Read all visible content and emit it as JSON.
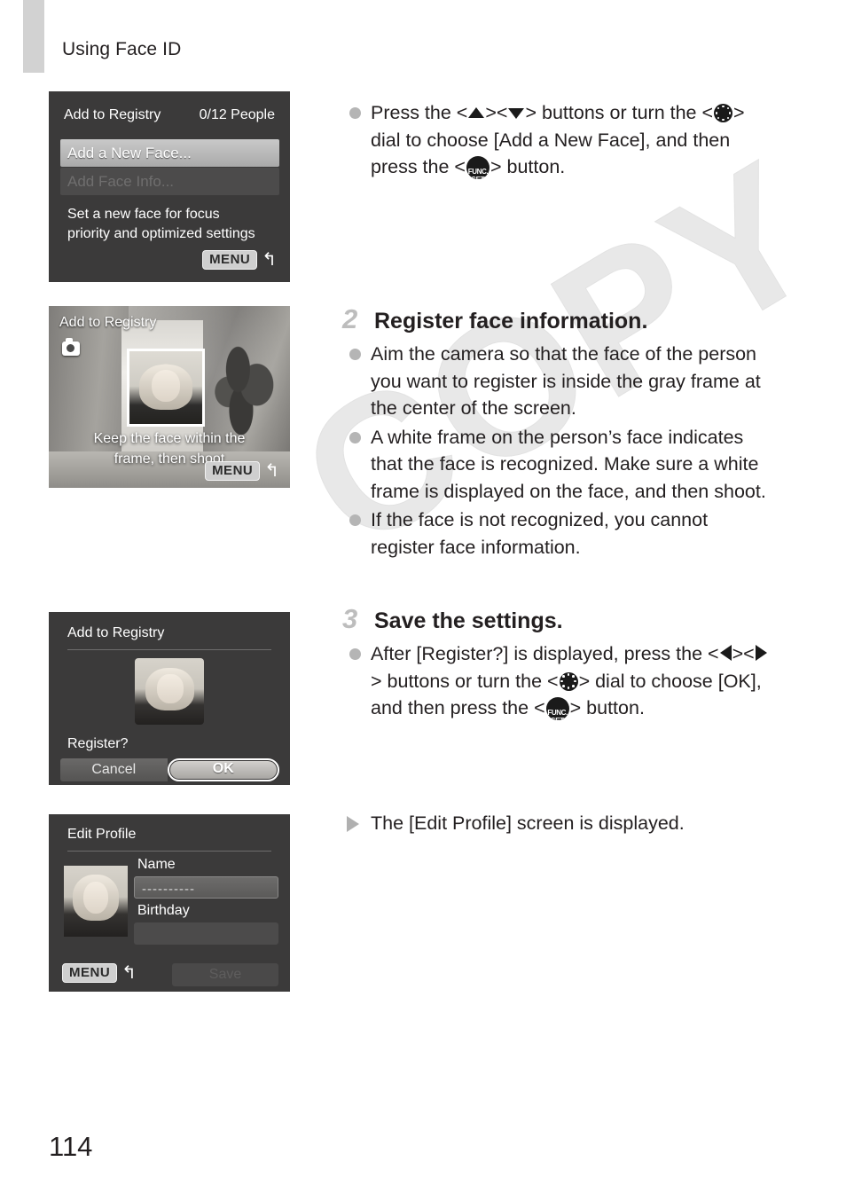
{
  "page": {
    "header": "Using Face ID",
    "number": "114",
    "watermark": "COPY"
  },
  "screens": {
    "add_to_registry_menu": {
      "title": "Add to Registry",
      "counter": "0/12 People",
      "item_selected": "Add a New Face...",
      "item_disabled": "Add Face Info...",
      "description_line1": "Set a new face for focus",
      "description_line2": "priority and optimized settings",
      "menu_label": "MENU",
      "menu_arrow": "↰"
    },
    "face_capture": {
      "title": "Add to Registry",
      "caption_line1": "Keep the face within the",
      "caption_line2": "frame, then shoot",
      "menu_label": "MENU",
      "menu_arrow": "↰"
    },
    "register_confirm": {
      "title": "Add to Registry",
      "question": "Register?",
      "cancel_label": "Cancel",
      "ok_label": "OK"
    },
    "edit_profile": {
      "title": "Edit Profile",
      "name_label": "Name",
      "name_value": "----------",
      "birthday_label": "Birthday",
      "birthday_value": "",
      "save_label": "Save",
      "menu_label": "MENU",
      "menu_arrow": "↰"
    }
  },
  "instructions": {
    "step1": {
      "part1": "Press the <",
      "part2": "><",
      "part3": "> buttons or turn the <",
      "part4": "> dial to choose [Add a New Face],",
      "part5": "and then press the <",
      "part6": "> button."
    },
    "step2": {
      "number": "2",
      "title": "Register face information.",
      "bullet1": "Aim the camera so that the face of the person you want to register is inside the gray frame at the center of the screen.",
      "bullet2": "A white frame on the person’s face indicates that the face is recognized. Make sure a white frame is displayed on the face, and then shoot.",
      "bullet3": "If the face is not recognized, you cannot register face information."
    },
    "step3": {
      "number": "3",
      "title": "Save the settings.",
      "bullet1_part1": "After [Register?] is displayed, press the <",
      "bullet1_part2": "><",
      "bullet1_part3": "> buttons or turn the <",
      "bullet1_part4": "> dial to choose [OK], and then press the <",
      "bullet1_part5": "> button.",
      "result": "The [Edit Profile] screen is displayed."
    }
  },
  "glyphs": {
    "func_top": "FUNC.",
    "func_bottom": "SET"
  }
}
